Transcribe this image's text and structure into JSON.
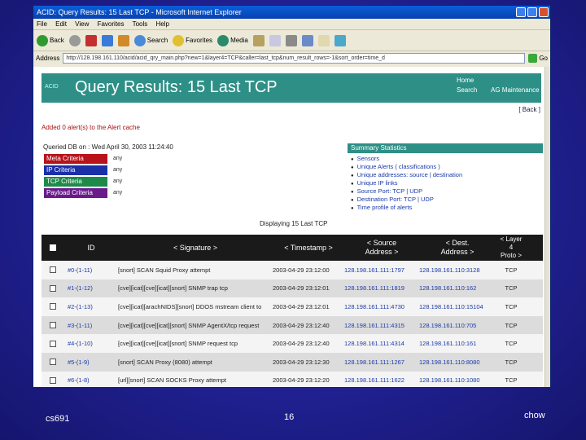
{
  "browser": {
    "window_title": "ACID: Query Results: 15 Last TCP - Microsoft Internet Explorer",
    "menu": [
      "File",
      "Edit",
      "View",
      "Favorites",
      "Tools",
      "Help"
    ],
    "toolbar": {
      "back": "Back",
      "search": "Search",
      "favorites": "Favorites",
      "media": "Media"
    },
    "address_label": "Address",
    "address_value": "http://128.198.161.110/acid/acid_qry_main.php?new=1&layer4=TCP&caller=last_tcp&num_result_rows=-1&sort_order=time_d",
    "go_label": "Go"
  },
  "page": {
    "acid_label": "ACID",
    "title": "Query Results: 15 Last TCP",
    "nav": {
      "home": "Home",
      "search": "Search",
      "ag": "AG Maintenance"
    },
    "back": "[ Back ]",
    "breadcrumb": "Added 0 alert(s) to the Alert cache",
    "queried": "Queried DB on : Wed April 30, 2003 11:24:40",
    "criteria": [
      {
        "label": "Meta Criteria",
        "value": "any",
        "color": "#b8121b"
      },
      {
        "label": "IP Criteria",
        "value": "any",
        "color": "#1b2fa8"
      },
      {
        "label": "TCP Criteria",
        "value": "any",
        "color": "#1d8a4a"
      },
      {
        "label": "Payload Criteria",
        "value": "any",
        "color": "#6a1a8a"
      }
    ],
    "stats": {
      "header": "Summary Statistics",
      "items": [
        "Sensors",
        "Unique Alerts  ( classifications )",
        "Unique addresses: source | destination",
        "Unique IP links",
        "Source Port: TCP | UDP",
        "Destination Port: TCP | UDP",
        "Time profile of alerts"
      ]
    },
    "displaying": "Displaying 15 Last TCP",
    "table": {
      "headers": {
        "id": "ID",
        "signature": "< Signature >",
        "timestamp": "< Timestamp >",
        "source": "< Source\nAddress >",
        "dest": "< Dest.\nAddress >",
        "layer4": "< Layer\n4\nProto >"
      },
      "rows": [
        {
          "id": "#0-(1-11)",
          "signature": "[snort] SCAN Squid Proxy attempt",
          "timestamp": "2003-04-29 23:12:00",
          "source": "128.198.161.111:1797",
          "dest": "128.198.161.110:3128",
          "proto": "TCP"
        },
        {
          "id": "#1-(1-12)",
          "signature": "[cve][icat][cve][icat][snort] SNMP trap tcp",
          "timestamp": "2003-04-29 23:12:01",
          "source": "128.198.161.111:1819",
          "dest": "128.198.161.110:162",
          "proto": "TCP"
        },
        {
          "id": "#2-(1-13)",
          "signature": "[cve][icat][arachNIDS][snort] DDOS mstream client to",
          "timestamp": "2003-04-29 23:12:01",
          "source": "128.198.161.111:4730",
          "dest": "128.198.161.110:15104",
          "proto": "TCP"
        },
        {
          "id": "#3-(1-11)",
          "signature": "[cve][icat][cve][icat][snort] SNMP AgentX/tcp request",
          "timestamp": "2003-04-29 23:12:40",
          "source": "128.198.161.111:4315",
          "dest": "128.198.161.110:705",
          "proto": "TCP"
        },
        {
          "id": "#4-(1-10)",
          "signature": "[cve][icat][cve][icat][snort] SNMP request tcp",
          "timestamp": "2003-04-29 23:12:40",
          "source": "128.198.161.111:4314",
          "dest": "128.198.161.110:161",
          "proto": "TCP"
        },
        {
          "id": "#5-(1-9)",
          "signature": "[snort] SCAN Proxy (8080) attempt",
          "timestamp": "2003-04-29 23:12:30",
          "source": "128.198.161.111:1267",
          "dest": "128.198.161.110:8080",
          "proto": "TCP"
        },
        {
          "id": "#6-(1-8)",
          "signature": "[url][snort] SCAN SOCKS Proxy attempt",
          "timestamp": "2003-04-29 23:12:20",
          "source": "128.198.161.111:1622",
          "dest": "128.198.161.110:1080",
          "proto": "TCP"
        }
      ]
    }
  },
  "footer": {
    "course": "cs691",
    "page_number": "16",
    "author": "chow"
  }
}
